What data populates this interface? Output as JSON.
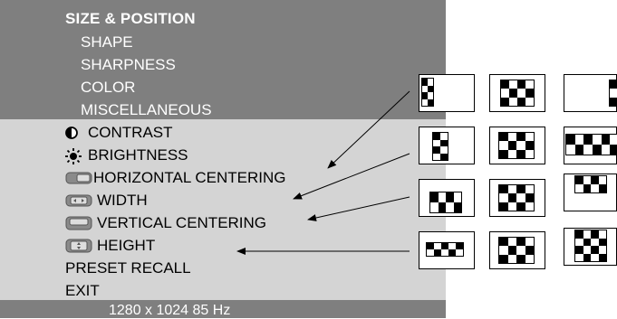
{
  "menu": {
    "title": "SIZE & POSITION",
    "submenus": [
      "SHAPE",
      "SHARPNESS",
      "COLOR",
      "MISCELLANEOUS"
    ],
    "items": [
      {
        "label": "CONTRAST",
        "icon": "contrast-icon"
      },
      {
        "label": "BRIGHTNESS",
        "icon": "brightness-icon"
      },
      {
        "label": "HORIZONTAL CENTERING",
        "icon": "horizontal-centering-icon"
      },
      {
        "label": "WIDTH",
        "icon": "width-icon"
      },
      {
        "label": "VERTICAL CENTERING",
        "icon": "vertical-centering-icon"
      },
      {
        "label": "HEIGHT",
        "icon": "height-icon"
      },
      {
        "label": "PRESET RECALL",
        "icon": ""
      },
      {
        "label": "EXIT",
        "icon": ""
      }
    ],
    "status": "1280 x 1024  85 Hz"
  },
  "colors": {
    "menu_dark": "#7f7f7f",
    "menu_light": "#d4d4d4",
    "highlight_text": "#ffffff",
    "text": "#000000"
  }
}
